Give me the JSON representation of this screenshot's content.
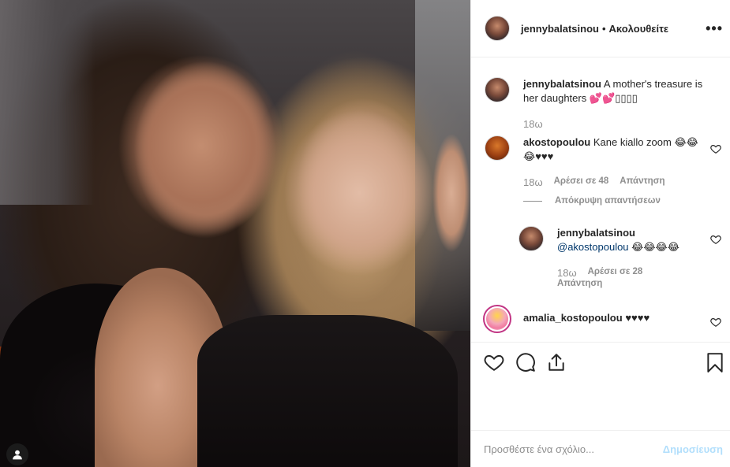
{
  "post": {
    "author": "jennybalatsinou",
    "separator": "•",
    "follow_status": "Ακολουθείτε",
    "more_icon": "more-horizontal-icon"
  },
  "caption": {
    "username": "jennybalatsinou",
    "text": "A mother's treasure is her daughters 💕💕▯▯▯▯",
    "time": "18ω"
  },
  "comments": [
    {
      "username": "akostopoulou",
      "text": "Kane kiallo zoom 😂😂😂♥♥♥",
      "time": "18ω",
      "likes": "Αρέσει σε 48",
      "reply_label": "Απάντηση"
    },
    {
      "hide_replies_label": "Απόκρυψη απαντήσεων"
    },
    {
      "username": "jennybalatsinou",
      "mention": "@akostopoulou",
      "text": "😂😂😂😂",
      "time": "18ω",
      "likes": "Αρέσει σε 28",
      "reply_label": "Απάντηση"
    },
    {
      "username": "amalia_kostopoulou",
      "text": "♥♥♥♥"
    }
  ],
  "actions": {
    "like_icon": "heart-icon",
    "comment_icon": "comment-icon",
    "share_icon": "share-icon",
    "save_icon": "bookmark-icon"
  },
  "add_comment": {
    "placeholder": "Προσθέστε ένα σχόλιο...",
    "post_label": "Δημοσίευση"
  },
  "colors": {
    "text": "#262626",
    "muted": "#8e8e8e",
    "link": "#00376b",
    "post_disabled": "#b2dffc",
    "border": "#efefef"
  }
}
